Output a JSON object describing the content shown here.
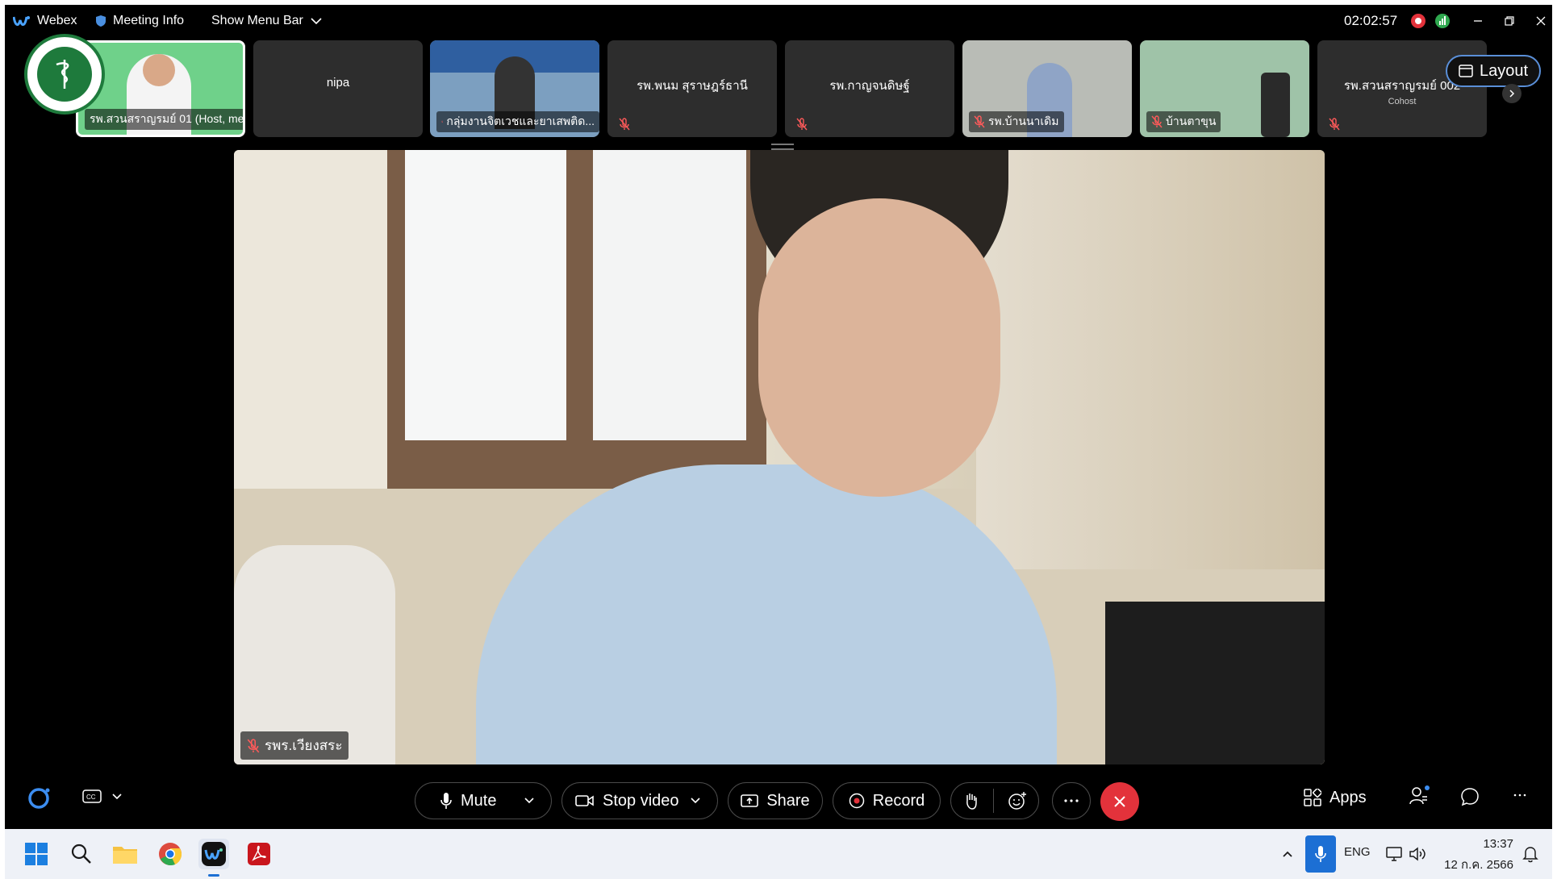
{
  "titlebar": {
    "app_name": "Webex",
    "meeting_info": "Meeting Info",
    "show_menu_bar": "Show Menu Bar",
    "timer": "02:02:57"
  },
  "thumbnails": [
    {
      "label": "รพ.สวนสราญรมย์ 01 (Host, me)",
      "type": "video"
    },
    {
      "name": "nipa",
      "type": "avatar"
    },
    {
      "label": "กลุ่มงานจิตเวชและยาเสพติด...",
      "type": "video"
    },
    {
      "name": "รพ.พนม สุราษฎร์ธานี",
      "type": "avatar"
    },
    {
      "name": "รพ.กาญจนดิษฐ์",
      "type": "avatar"
    },
    {
      "label": "รพ.บ้านนาเดิม",
      "type": "video"
    },
    {
      "label": "บ้านตาขุน",
      "type": "video"
    },
    {
      "name": "รพ.สวนสราญรมย์ 002",
      "sub": "Cohost",
      "type": "avatar"
    }
  ],
  "layout_button": "Layout",
  "main_video": {
    "label": "รพร.เวียงสระ"
  },
  "controls": {
    "mute": "Mute",
    "stop_video": "Stop video",
    "share": "Share",
    "record": "Record",
    "apps": "Apps"
  },
  "taskbar": {
    "lang": "ENG",
    "time": "13:37",
    "date": "12 ก.ค. 2566"
  },
  "colors": {
    "end_call": "#e3323b",
    "record_dot": "#e3323b",
    "accent": "#1c6fd4"
  }
}
